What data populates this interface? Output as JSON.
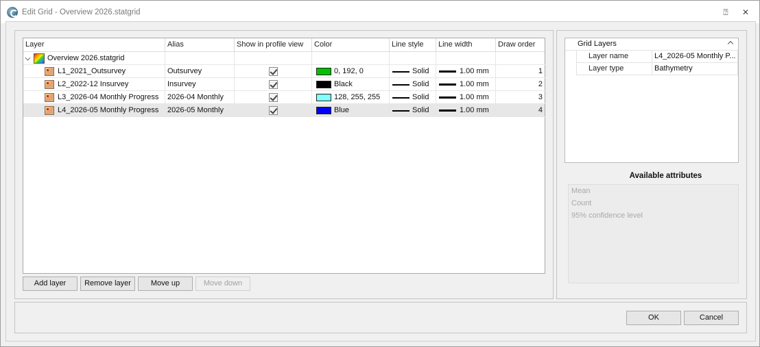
{
  "window": {
    "title": "Edit Grid - Overview 2026.statgrid",
    "help_glyph": "⍰",
    "close_glyph": "✕"
  },
  "grid": {
    "columns": [
      "Layer",
      "Alias",
      "Show in profile view",
      "Color",
      "Line style",
      "Line width",
      "Draw order"
    ],
    "root_label": "Overview 2026.statgrid",
    "rows": [
      {
        "layer": "L1_2021_Outsurvey",
        "alias": "Outsurvey",
        "show": true,
        "color_hex": "#00c000",
        "color_text": "0, 192, 0",
        "line_style": "Solid",
        "line_width": "1.00 mm",
        "draw_order": "1"
      },
      {
        "layer": "L2_2022-12 Insurvey",
        "alias": "Insurvey",
        "show": true,
        "color_hex": "#000000",
        "color_text": "Black",
        "line_style": "Solid",
        "line_width": "1.00 mm",
        "draw_order": "2"
      },
      {
        "layer": "L3_2026-04 Monthly Progress",
        "alias": "2026-04  Monthly",
        "show": true,
        "color_hex": "#80ffff",
        "color_text": "128, 255, 255",
        "line_style": "Solid",
        "line_width": "1.00 mm",
        "draw_order": "3"
      },
      {
        "layer": "L4_2026-05 Monthly Progress",
        "alias": "2026-05  Monthly",
        "show": true,
        "color_hex": "#0000ff",
        "color_text": "Blue",
        "line_style": "Solid",
        "line_width": "1.00 mm",
        "draw_order": "4"
      }
    ],
    "selected_row": 3
  },
  "buttons": {
    "add_layer": "Add layer",
    "remove_layer": "Remove layer",
    "move_up": "Move up",
    "move_down": "Move down",
    "ok": "OK",
    "cancel": "Cancel"
  },
  "properties": {
    "group": "Grid Layers",
    "rows": [
      {
        "key": "Layer name",
        "value": "L4_2026-05 Monthly P..."
      },
      {
        "key": "Layer type",
        "value": "Bathymetry"
      }
    ]
  },
  "available_attributes": {
    "title": "Available attributes",
    "items": [
      "Mean",
      "Count",
      "95% confidence level"
    ]
  }
}
